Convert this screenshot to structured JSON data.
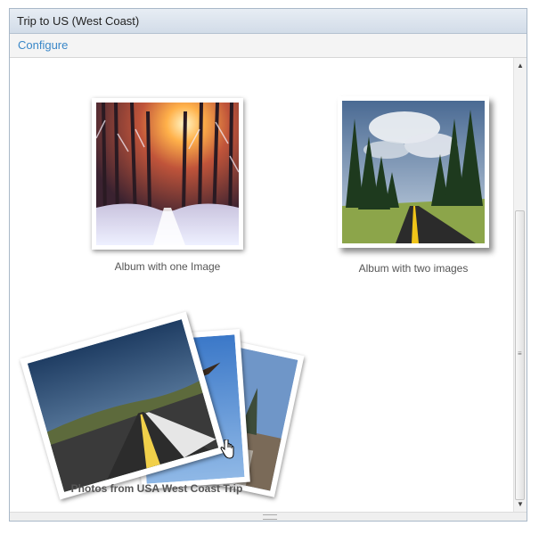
{
  "window": {
    "title": "Trip to US (West Coast)"
  },
  "toolbar": {
    "configure_label": "Configure"
  },
  "albums": [
    {
      "label": "Album with one Image",
      "icon": "winter-forest-image"
    },
    {
      "label": "Album with two images",
      "icon": "forest-road-image"
    },
    {
      "label": "Photos from USA West Coast Trip",
      "icon": "photo-stack-image"
    }
  ],
  "colors": {
    "accent": "#3a87c8",
    "title_bar": "#dbe3ec",
    "border": "#a9b8c8"
  }
}
